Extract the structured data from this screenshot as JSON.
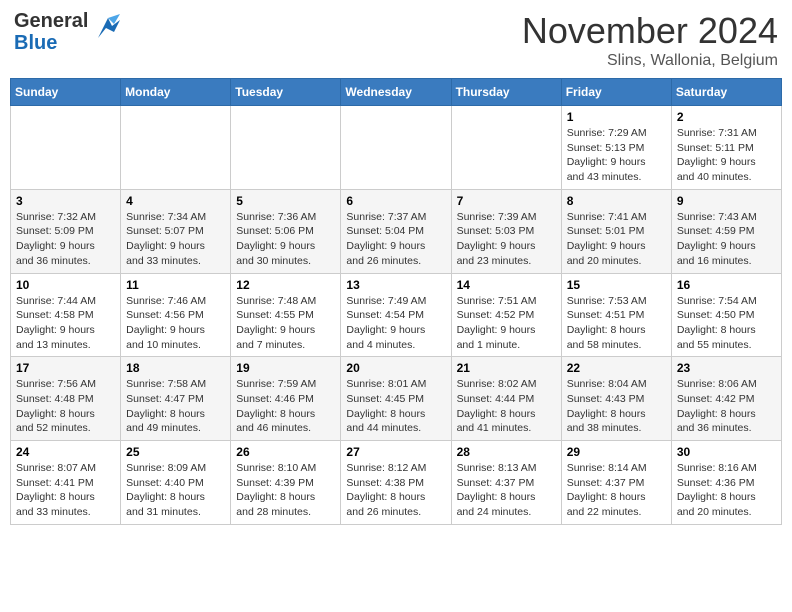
{
  "header": {
    "logo_general": "General",
    "logo_blue": "Blue",
    "month_title": "November 2024",
    "location": "Slins, Wallonia, Belgium"
  },
  "days_of_week": [
    "Sunday",
    "Monday",
    "Tuesday",
    "Wednesday",
    "Thursday",
    "Friday",
    "Saturday"
  ],
  "weeks": [
    {
      "days": [
        {
          "number": "",
          "info": ""
        },
        {
          "number": "",
          "info": ""
        },
        {
          "number": "",
          "info": ""
        },
        {
          "number": "",
          "info": ""
        },
        {
          "number": "",
          "info": ""
        },
        {
          "number": "1",
          "info": "Sunrise: 7:29 AM\nSunset: 5:13 PM\nDaylight: 9 hours and 43 minutes."
        },
        {
          "number": "2",
          "info": "Sunrise: 7:31 AM\nSunset: 5:11 PM\nDaylight: 9 hours and 40 minutes."
        }
      ]
    },
    {
      "days": [
        {
          "number": "3",
          "info": "Sunrise: 7:32 AM\nSunset: 5:09 PM\nDaylight: 9 hours and 36 minutes."
        },
        {
          "number": "4",
          "info": "Sunrise: 7:34 AM\nSunset: 5:07 PM\nDaylight: 9 hours and 33 minutes."
        },
        {
          "number": "5",
          "info": "Sunrise: 7:36 AM\nSunset: 5:06 PM\nDaylight: 9 hours and 30 minutes."
        },
        {
          "number": "6",
          "info": "Sunrise: 7:37 AM\nSunset: 5:04 PM\nDaylight: 9 hours and 26 minutes."
        },
        {
          "number": "7",
          "info": "Sunrise: 7:39 AM\nSunset: 5:03 PM\nDaylight: 9 hours and 23 minutes."
        },
        {
          "number": "8",
          "info": "Sunrise: 7:41 AM\nSunset: 5:01 PM\nDaylight: 9 hours and 20 minutes."
        },
        {
          "number": "9",
          "info": "Sunrise: 7:43 AM\nSunset: 4:59 PM\nDaylight: 9 hours and 16 minutes."
        }
      ]
    },
    {
      "days": [
        {
          "number": "10",
          "info": "Sunrise: 7:44 AM\nSunset: 4:58 PM\nDaylight: 9 hours and 13 minutes."
        },
        {
          "number": "11",
          "info": "Sunrise: 7:46 AM\nSunset: 4:56 PM\nDaylight: 9 hours and 10 minutes."
        },
        {
          "number": "12",
          "info": "Sunrise: 7:48 AM\nSunset: 4:55 PM\nDaylight: 9 hours and 7 minutes."
        },
        {
          "number": "13",
          "info": "Sunrise: 7:49 AM\nSunset: 4:54 PM\nDaylight: 9 hours and 4 minutes."
        },
        {
          "number": "14",
          "info": "Sunrise: 7:51 AM\nSunset: 4:52 PM\nDaylight: 9 hours and 1 minute."
        },
        {
          "number": "15",
          "info": "Sunrise: 7:53 AM\nSunset: 4:51 PM\nDaylight: 8 hours and 58 minutes."
        },
        {
          "number": "16",
          "info": "Sunrise: 7:54 AM\nSunset: 4:50 PM\nDaylight: 8 hours and 55 minutes."
        }
      ]
    },
    {
      "days": [
        {
          "number": "17",
          "info": "Sunrise: 7:56 AM\nSunset: 4:48 PM\nDaylight: 8 hours and 52 minutes."
        },
        {
          "number": "18",
          "info": "Sunrise: 7:58 AM\nSunset: 4:47 PM\nDaylight: 8 hours and 49 minutes."
        },
        {
          "number": "19",
          "info": "Sunrise: 7:59 AM\nSunset: 4:46 PM\nDaylight: 8 hours and 46 minutes."
        },
        {
          "number": "20",
          "info": "Sunrise: 8:01 AM\nSunset: 4:45 PM\nDaylight: 8 hours and 44 minutes."
        },
        {
          "number": "21",
          "info": "Sunrise: 8:02 AM\nSunset: 4:44 PM\nDaylight: 8 hours and 41 minutes."
        },
        {
          "number": "22",
          "info": "Sunrise: 8:04 AM\nSunset: 4:43 PM\nDaylight: 8 hours and 38 minutes."
        },
        {
          "number": "23",
          "info": "Sunrise: 8:06 AM\nSunset: 4:42 PM\nDaylight: 8 hours and 36 minutes."
        }
      ]
    },
    {
      "days": [
        {
          "number": "24",
          "info": "Sunrise: 8:07 AM\nSunset: 4:41 PM\nDaylight: 8 hours and 33 minutes."
        },
        {
          "number": "25",
          "info": "Sunrise: 8:09 AM\nSunset: 4:40 PM\nDaylight: 8 hours and 31 minutes."
        },
        {
          "number": "26",
          "info": "Sunrise: 8:10 AM\nSunset: 4:39 PM\nDaylight: 8 hours and 28 minutes."
        },
        {
          "number": "27",
          "info": "Sunrise: 8:12 AM\nSunset: 4:38 PM\nDaylight: 8 hours and 26 minutes."
        },
        {
          "number": "28",
          "info": "Sunrise: 8:13 AM\nSunset: 4:37 PM\nDaylight: 8 hours and 24 minutes."
        },
        {
          "number": "29",
          "info": "Sunrise: 8:14 AM\nSunset: 4:37 PM\nDaylight: 8 hours and 22 minutes."
        },
        {
          "number": "30",
          "info": "Sunrise: 8:16 AM\nSunset: 4:36 PM\nDaylight: 8 hours and 20 minutes."
        }
      ]
    }
  ]
}
